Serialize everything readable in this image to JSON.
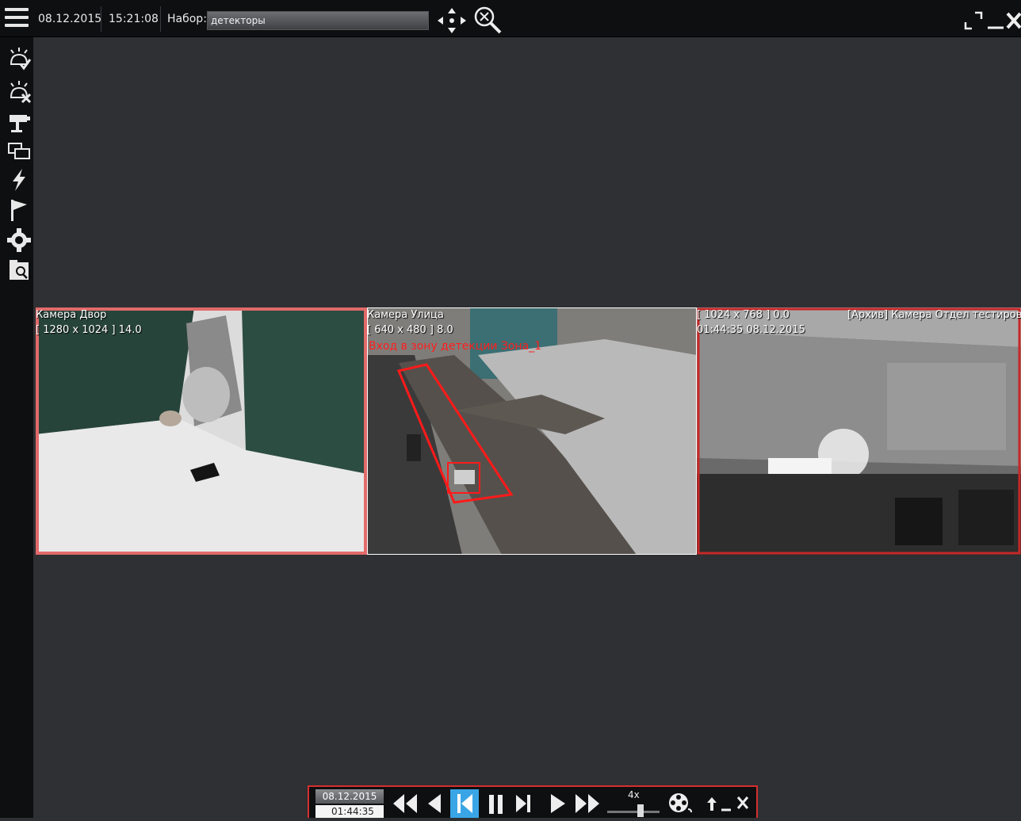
{
  "topbar": {
    "date": "08.12.2015",
    "time": "15:21:08",
    "set_label": "Набор:",
    "set_value": "детекторы"
  },
  "sidebar": {
    "items": [
      {
        "icon": "alarm-confirm-icon"
      },
      {
        "icon": "alarm-cancel-icon"
      },
      {
        "icon": "camera-icon"
      },
      {
        "icon": "layouts-icon"
      },
      {
        "icon": "events-lightning-icon"
      },
      {
        "icon": "flag-icon"
      },
      {
        "icon": "settings-gear-icon"
      },
      {
        "icon": "archive-search-icon"
      }
    ]
  },
  "cameras": [
    {
      "name": "Камера Двор",
      "resolution": "[ 1280 x 1024 ] 14.0",
      "border_color": "#e26a6a"
    },
    {
      "name": "Камера Улица",
      "resolution": "[ 640 x 480 ] 8.0",
      "event_text": "Вход в зону детекции Зона_1",
      "border_color": "#ffffff"
    },
    {
      "name": "[Архив] Камера Отдел тестировани",
      "resolution": "[ 1024 x 768 ] 0.0",
      "timestamp": "01:44:35 08.12.2015",
      "border_color": "#c62828"
    }
  ],
  "player": {
    "date": "08.12.2015",
    "time": "01:44:35",
    "speed": "4x"
  },
  "colors": {
    "background": "#2f3033",
    "bar": "#0e0f11",
    "accent_blue": "#3aa5e6",
    "alert_red": "#d32f2f"
  }
}
